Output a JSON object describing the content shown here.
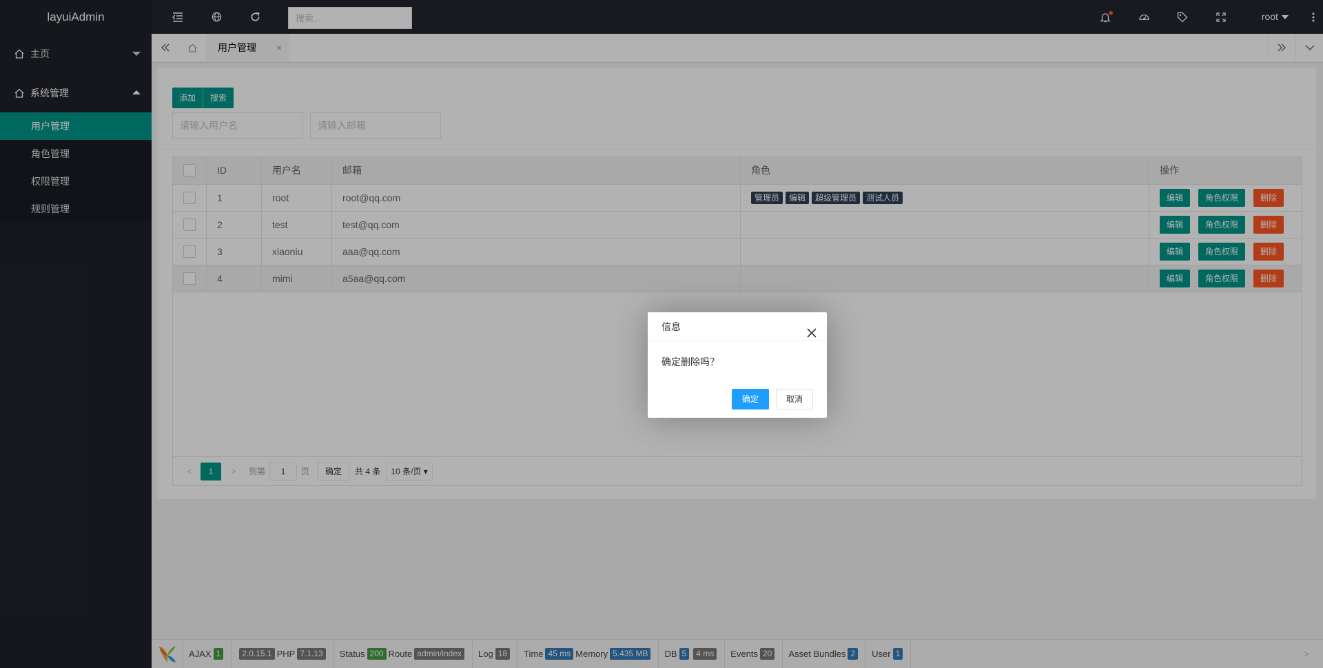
{
  "sidebar": {
    "logo": "layuiAdmin",
    "groups": [
      {
        "label": "主页",
        "icon": "home-icon",
        "open": false
      },
      {
        "label": "系统管理",
        "icon": "home-icon",
        "open": true,
        "items": [
          {
            "label": "用户管理",
            "active": true
          },
          {
            "label": "角色管理",
            "active": false
          },
          {
            "label": "权限管理",
            "active": false
          },
          {
            "label": "规则管理",
            "active": false
          }
        ]
      }
    ]
  },
  "header": {
    "search_placeholder": "搜索...",
    "user": "root",
    "icons": [
      "shrink-icon",
      "globe-icon",
      "refresh-icon",
      "bell-icon",
      "theme-icon",
      "tag-icon",
      "fullscreen-icon",
      "more-icon"
    ]
  },
  "tabs": {
    "current": "用户管理",
    "close": "×"
  },
  "toolbar": {
    "add": "添加",
    "search": "搜索"
  },
  "filters": {
    "username_placeholder": "请输入用户名",
    "email_placeholder": "请输入邮箱"
  },
  "table": {
    "headers": {
      "id": "ID",
      "username": "用户名",
      "email": "邮箱",
      "role": "角色",
      "ops": "操作"
    },
    "rows": [
      {
        "id": "1",
        "username": "root",
        "email": "root@qq.com",
        "roles": [
          "管理员",
          "编辑",
          "超级管理员",
          "测试人员"
        ]
      },
      {
        "id": "2",
        "username": "test",
        "email": "test@qq.com",
        "roles": []
      },
      {
        "id": "3",
        "username": "xiaoniu",
        "email": "aaa@qq.com",
        "roles": []
      },
      {
        "id": "4",
        "username": "mimi",
        "email": "a5aa@qq.com",
        "roles": []
      }
    ],
    "actions": {
      "edit": "编辑",
      "perm": "角色权限",
      "delete": "删除"
    }
  },
  "pager": {
    "prev": "<",
    "next": ">",
    "current": "1",
    "goto": "到第",
    "goto_value": "1",
    "page": "页",
    "confirm": "确定",
    "total": "共 4 条",
    "size": "10 条/页"
  },
  "debug": {
    "ajax": "AJAX",
    "ajax_count": "1",
    "version": "2.0.15.1",
    "php": "PHP",
    "php_version": "7.1.13",
    "status": "Status",
    "status_code": "200",
    "route": "Route",
    "route_value": "admin/index",
    "log": "Log",
    "log_count": "18",
    "time": "Time",
    "time_value": "45 ms",
    "memory": "Memory",
    "memory_value": "5.435 MB",
    "db": "DB",
    "db_count": "5",
    "db_time": "4 ms",
    "events": "Events",
    "events_count": "20",
    "assets": "Asset Bundles",
    "assets_count": "2",
    "user": "User",
    "user_count": "1",
    "more": ">"
  },
  "dialog": {
    "title": "信息",
    "message": "确定删除吗？",
    "ok": "确定",
    "cancel": "取消"
  },
  "colors": {
    "primary": "#009688",
    "danger": "#ff5722",
    "dialog_ok": "#1e9fff",
    "dark": "#20222a"
  }
}
